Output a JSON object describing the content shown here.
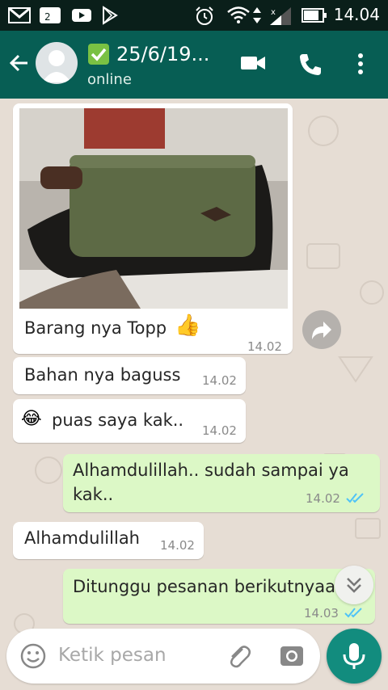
{
  "status_bar": {
    "time": "14.04"
  },
  "header": {
    "title": "25/6/19...",
    "subtitle": "online"
  },
  "messages": [
    {
      "text": "Barang nya Topp",
      "time": "14.02",
      "emoji": "👍"
    },
    {
      "text": "Bahan nya baguss",
      "time": "14.02"
    },
    {
      "text": "puas saya kak..",
      "time": "14.02",
      "emoji": "😂"
    },
    {
      "text_line1": "Alhamdulillah.. sudah sampai ya",
      "text_line2": "kak..",
      "time": "14.02"
    },
    {
      "text": "Alhamdulillah",
      "time": "14.02"
    },
    {
      "text": "Ditunggu pesanan berikutnyaa",
      "time": "14.03"
    }
  ],
  "composer": {
    "placeholder": "Ketik pesan"
  },
  "colors": {
    "header": "#075e54",
    "outgoing": "#dcf8c6",
    "incoming": "#ffffff",
    "read_tick": "#4fc3f7",
    "accent": "#128c7e"
  }
}
